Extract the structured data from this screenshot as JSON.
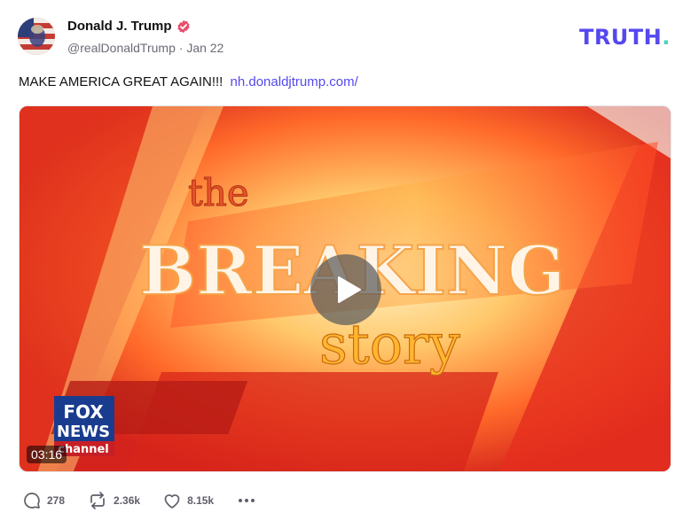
{
  "post": {
    "display_name": "Donald J. Trump",
    "handle": "@realDonaldTrump",
    "separator": "·",
    "date": "Jan 22",
    "text": "MAKE AMERICA GREAT AGAIN!!!",
    "link": "nh.donaldjtrump.com/"
  },
  "brand": {
    "logo_text": "TRUTH",
    "logo_dot": ".",
    "accent_color": "#5448ee",
    "dot_color": "#4fd1c5"
  },
  "video": {
    "title_line1": "the",
    "title_line2": "BREAKING",
    "title_line3": "story",
    "network_top": "FOX",
    "network_mid": "NEWS",
    "network_bottom": "channel",
    "duration": "03:16"
  },
  "actions": {
    "replies": "278",
    "retruths": "2.36k",
    "likes": "8.15k"
  },
  "icons": [
    "verified-badge-icon",
    "reply-icon",
    "retruth-icon",
    "heart-icon",
    "more-icon",
    "play-icon"
  ]
}
